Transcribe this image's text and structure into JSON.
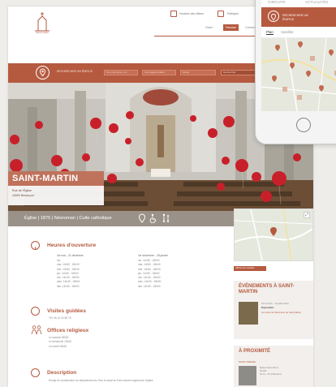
{
  "header": {
    "logo_text": "saint-martin",
    "links": [
      "Horaires des offices",
      "Participer"
    ],
    "nav": [
      "Visiter",
      "Paroisse",
      "Contacts"
    ]
  },
  "search": {
    "label": "RECHERCHER UN ÉDIFICE",
    "fields": [
      "Une commune, un...",
      "Une agglomération",
      "Accès",
      "Rechercher"
    ]
  },
  "hero": {
    "title": "SAINT-MARTIN",
    "address_lines": [
      "Rue de l'Église",
      "44500 Besançon"
    ]
  },
  "meta": {
    "text": "Église | 1875 | Néoroman | Culte catholique"
  },
  "hours": {
    "title": "Heures d'ouverture",
    "period1": "1er mai – 31 décembre",
    "period2": "1er décembre – 28 janvier",
    "rows1": [
      "lun.",
      "mar. 14h30 - 18h00",
      "mer. 14h30 - 18h00",
      "jeu. 14h30 - 18h00",
      "ven. 14h30 - 18h00",
      "sam. 14h30 - 18h00",
      "dim. 14h30 - 18h00"
    ],
    "rows2": [
      "lun. 14h30 - 18h00",
      "mar. 14h30 - 18h00",
      "mer. 14h30 - 18h00",
      "jeu. 14h30 - 18h00",
      "ven. 14h30 - 18h00",
      "sam. 14h30 - 18h00",
      "dim. 14h30 - 18h00"
    ]
  },
  "guided": {
    "title": "Visites guidées",
    "text": "Tél. 06 12 34 56 78"
  },
  "offices": {
    "title": "Offices religieux",
    "lines": [
      "Le samedi 18h30",
      "Le dimanche 10h00",
      "Le mardi 18h30"
    ]
  },
  "description": {
    "title": "Description",
    "text": "Rouge du constructeur du département du Tarn et aussi du Parc naturel régional de l'église"
  },
  "right": {
    "cta": "Afficher les résultats",
    "events_title": "ÉVÉNEMENTS À SAINT-MARTIN",
    "event_date": "04.10 Août – 10 juillet 2021",
    "event_name": "Exposition",
    "event_desc": "Les amis du Patrimoine de Saint-Martin",
    "nearby_title": "À PROXIMITÉ",
    "nearby_name": "SAINT-PIERRE",
    "nearby_lines": [
      "Église Saint-Pierre",
      "Deville",
      "03 14 - 20 4 Bertrand"
    ]
  },
  "phone": {
    "tabs": [
      "CIRCUITS",
      "ACTUALITÉS"
    ],
    "banner": "RECHERCHER UN ÉDIFICE",
    "toggle": [
      "Plan",
      "Satellite"
    ]
  },
  "colors": {
    "accent": "#b55a3f",
    "meta_bar": "#9a9288"
  }
}
